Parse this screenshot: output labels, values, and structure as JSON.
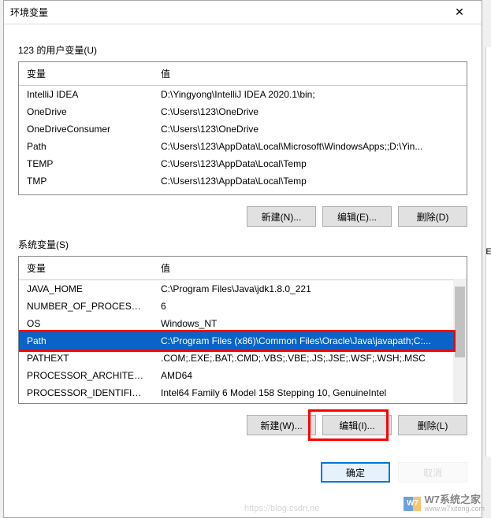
{
  "dialog": {
    "title": "环境变量",
    "close_glyph": "✕"
  },
  "user_vars": {
    "section_label": "123 的用户变量(U)",
    "header_name": "变量",
    "header_value": "值",
    "rows": [
      {
        "name": "IntelliJ IDEA",
        "value": "D:\\Yingyong\\IntelliJ IDEA 2020.1\\bin;"
      },
      {
        "name": "OneDrive",
        "value": "C:\\Users\\123\\OneDrive"
      },
      {
        "name": "OneDriveConsumer",
        "value": "C:\\Users\\123\\OneDrive"
      },
      {
        "name": "Path",
        "value": "C:\\Users\\123\\AppData\\Local\\Microsoft\\WindowsApps;;D:\\Yin..."
      },
      {
        "name": "TEMP",
        "value": "C:\\Users\\123\\AppData\\Local\\Temp"
      },
      {
        "name": "TMP",
        "value": "C:\\Users\\123\\AppData\\Local\\Temp"
      }
    ],
    "buttons": {
      "new": "新建(N)...",
      "edit": "编辑(E)...",
      "delete": "删除(D)"
    }
  },
  "system_vars": {
    "section_label": "系统变量(S)",
    "header_name": "变量",
    "header_value": "值",
    "rows": [
      {
        "name": "JAVA_HOME",
        "value": "C:\\Program Files\\Java\\jdk1.8.0_221"
      },
      {
        "name": "NUMBER_OF_PROCESSORS",
        "value": "6"
      },
      {
        "name": "OS",
        "value": "Windows_NT"
      },
      {
        "name": "Path",
        "value": "C:\\Program Files (x86)\\Common Files\\Oracle\\Java\\javapath;C:...",
        "selected": true
      },
      {
        "name": "PATHEXT",
        "value": ".COM;.EXE;.BAT;.CMD;.VBS;.VBE;.JS;.JSE;.WSF;.WSH;.MSC"
      },
      {
        "name": "PROCESSOR_ARCHITECTURE",
        "value": "AMD64"
      },
      {
        "name": "PROCESSOR_IDENTIFIER",
        "value": "Intel64 Family 6 Model 158 Stepping 10, GenuineIntel"
      }
    ],
    "buttons": {
      "new": "新建(W)...",
      "edit": "编辑(I)...",
      "delete": "删除(L)"
    }
  },
  "footer": {
    "ok": "确定",
    "cancel": "取消"
  },
  "watermarks": {
    "csdn": "https://blog.csdn.ne",
    "w7": "W7",
    "w7_text": "W7系统之家",
    "w7_url": "www.w7xitong.com"
  },
  "right_edge_letter": "E"
}
